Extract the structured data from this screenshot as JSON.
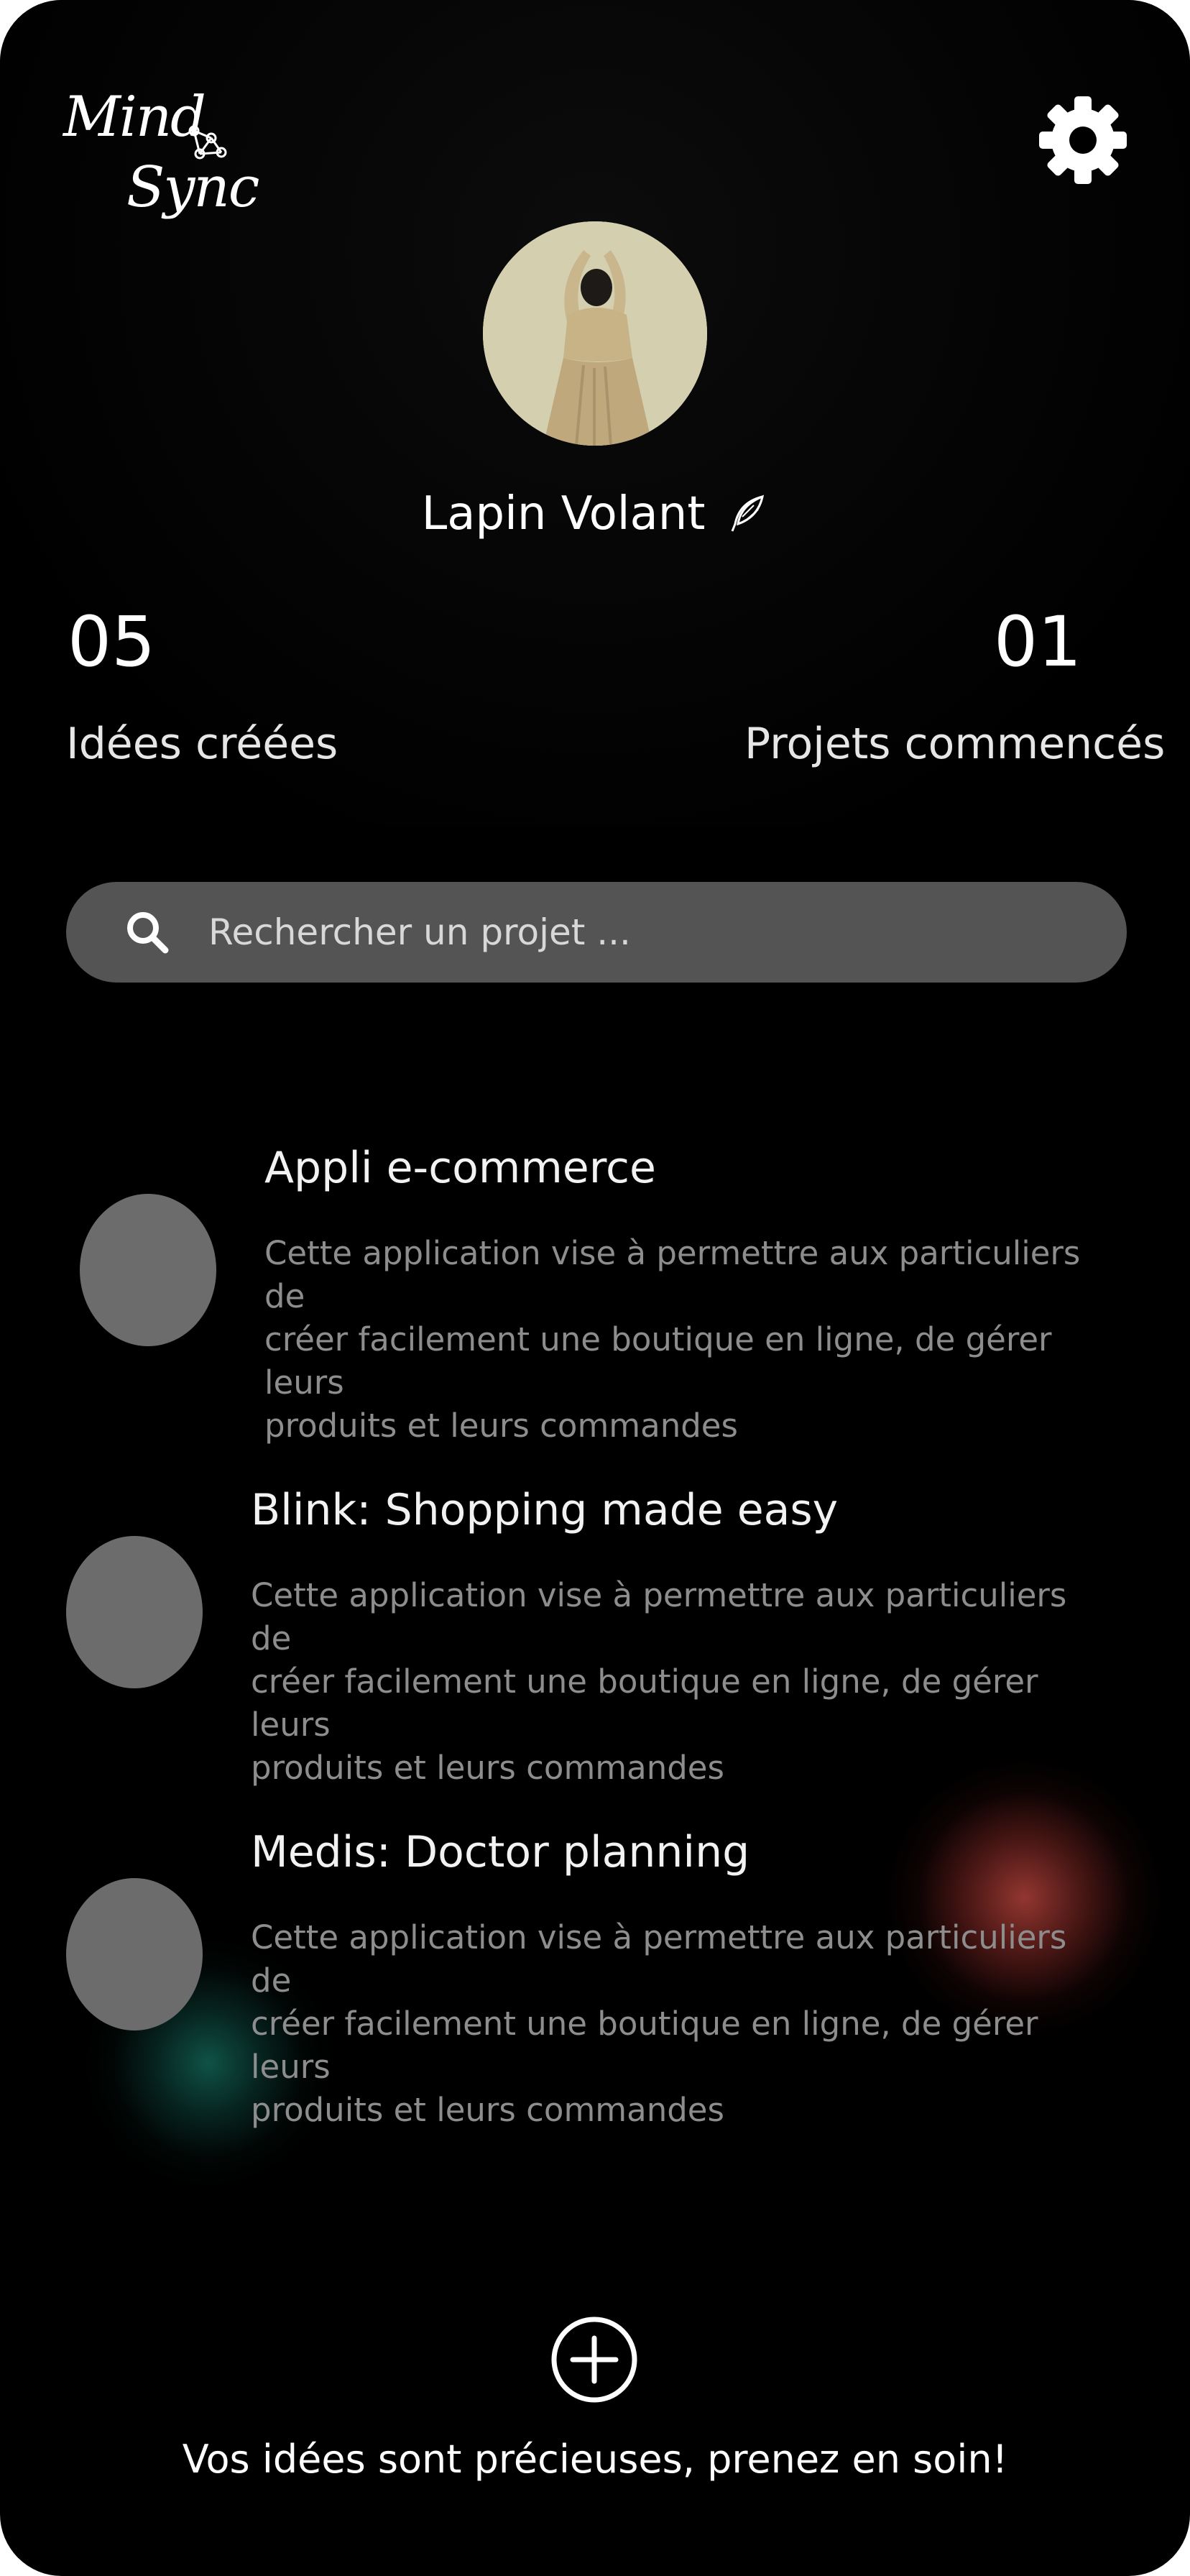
{
  "app": {
    "logo_line1": "Mind",
    "logo_line2": "Sync"
  },
  "icons": {
    "settings": "gear-icon",
    "username_badge": "feather-icon",
    "search": "search-icon",
    "add": "plus-circle-icon",
    "logo_mark": "molecule-icon"
  },
  "profile": {
    "name": "Lapin Volant"
  },
  "stats": {
    "ideas_count": "05",
    "ideas_label": "Idées  créées",
    "projects_count": "01",
    "projects_label": "Projets commencés"
  },
  "search": {
    "placeholder": "Rechercher un projet ..."
  },
  "projects": [
    {
      "title": "Appli e-commerce",
      "line1": "Cette application vise à permettre aux particuliers de",
      "line2": "créer facilement une boutique en ligne, de gérer leurs",
      "line3": "produits  et leurs commandes"
    },
    {
      "title": "Blink: Shopping made easy",
      "line1": "Cette application vise à permettre aux particuliers de",
      "line2": "créer facilement une boutique en ligne, de gérer leurs",
      "line3": "produits  et leurs commandes"
    },
    {
      "title": "Medis: Doctor planning",
      "line1": "Cette application vise à permettre aux particuliers de",
      "line2": "créer facilement une boutique en ligne, de gérer leurs",
      "line3": "produits  et leurs commandes"
    }
  ],
  "footer": {
    "tagline": "Vos idées sont précieuses, prenez en soin!"
  },
  "colors": {
    "background": "#000000",
    "search_bg": "#545454",
    "project_dot": "#6c6c6c",
    "description_text": "#8d8d8d",
    "accent_red_glow": "#c44840",
    "accent_teal_glow": "#146e5f"
  }
}
